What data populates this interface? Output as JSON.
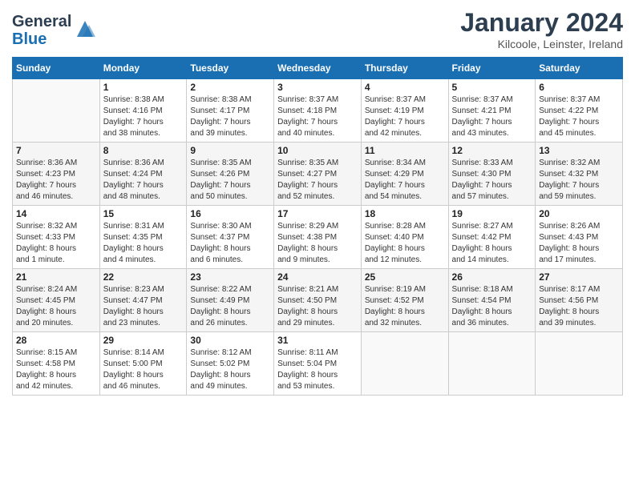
{
  "header": {
    "logo_general": "General",
    "logo_blue": "Blue",
    "month_title": "January 2024",
    "location": "Kilcoole, Leinster, Ireland"
  },
  "days_of_week": [
    "Sunday",
    "Monday",
    "Tuesday",
    "Wednesday",
    "Thursday",
    "Friday",
    "Saturday"
  ],
  "weeks": [
    [
      {
        "day": "",
        "info": ""
      },
      {
        "day": "1",
        "info": "Sunrise: 8:38 AM\nSunset: 4:16 PM\nDaylight: 7 hours\nand 38 minutes."
      },
      {
        "day": "2",
        "info": "Sunrise: 8:38 AM\nSunset: 4:17 PM\nDaylight: 7 hours\nand 39 minutes."
      },
      {
        "day": "3",
        "info": "Sunrise: 8:37 AM\nSunset: 4:18 PM\nDaylight: 7 hours\nand 40 minutes."
      },
      {
        "day": "4",
        "info": "Sunrise: 8:37 AM\nSunset: 4:19 PM\nDaylight: 7 hours\nand 42 minutes."
      },
      {
        "day": "5",
        "info": "Sunrise: 8:37 AM\nSunset: 4:21 PM\nDaylight: 7 hours\nand 43 minutes."
      },
      {
        "day": "6",
        "info": "Sunrise: 8:37 AM\nSunset: 4:22 PM\nDaylight: 7 hours\nand 45 minutes."
      }
    ],
    [
      {
        "day": "7",
        "info": "Sunrise: 8:36 AM\nSunset: 4:23 PM\nDaylight: 7 hours\nand 46 minutes."
      },
      {
        "day": "8",
        "info": "Sunrise: 8:36 AM\nSunset: 4:24 PM\nDaylight: 7 hours\nand 48 minutes."
      },
      {
        "day": "9",
        "info": "Sunrise: 8:35 AM\nSunset: 4:26 PM\nDaylight: 7 hours\nand 50 minutes."
      },
      {
        "day": "10",
        "info": "Sunrise: 8:35 AM\nSunset: 4:27 PM\nDaylight: 7 hours\nand 52 minutes."
      },
      {
        "day": "11",
        "info": "Sunrise: 8:34 AM\nSunset: 4:29 PM\nDaylight: 7 hours\nand 54 minutes."
      },
      {
        "day": "12",
        "info": "Sunrise: 8:33 AM\nSunset: 4:30 PM\nDaylight: 7 hours\nand 57 minutes."
      },
      {
        "day": "13",
        "info": "Sunrise: 8:32 AM\nSunset: 4:32 PM\nDaylight: 7 hours\nand 59 minutes."
      }
    ],
    [
      {
        "day": "14",
        "info": "Sunrise: 8:32 AM\nSunset: 4:33 PM\nDaylight: 8 hours\nand 1 minute."
      },
      {
        "day": "15",
        "info": "Sunrise: 8:31 AM\nSunset: 4:35 PM\nDaylight: 8 hours\nand 4 minutes."
      },
      {
        "day": "16",
        "info": "Sunrise: 8:30 AM\nSunset: 4:37 PM\nDaylight: 8 hours\nand 6 minutes."
      },
      {
        "day": "17",
        "info": "Sunrise: 8:29 AM\nSunset: 4:38 PM\nDaylight: 8 hours\nand 9 minutes."
      },
      {
        "day": "18",
        "info": "Sunrise: 8:28 AM\nSunset: 4:40 PM\nDaylight: 8 hours\nand 12 minutes."
      },
      {
        "day": "19",
        "info": "Sunrise: 8:27 AM\nSunset: 4:42 PM\nDaylight: 8 hours\nand 14 minutes."
      },
      {
        "day": "20",
        "info": "Sunrise: 8:26 AM\nSunset: 4:43 PM\nDaylight: 8 hours\nand 17 minutes."
      }
    ],
    [
      {
        "day": "21",
        "info": "Sunrise: 8:24 AM\nSunset: 4:45 PM\nDaylight: 8 hours\nand 20 minutes."
      },
      {
        "day": "22",
        "info": "Sunrise: 8:23 AM\nSunset: 4:47 PM\nDaylight: 8 hours\nand 23 minutes."
      },
      {
        "day": "23",
        "info": "Sunrise: 8:22 AM\nSunset: 4:49 PM\nDaylight: 8 hours\nand 26 minutes."
      },
      {
        "day": "24",
        "info": "Sunrise: 8:21 AM\nSunset: 4:50 PM\nDaylight: 8 hours\nand 29 minutes."
      },
      {
        "day": "25",
        "info": "Sunrise: 8:19 AM\nSunset: 4:52 PM\nDaylight: 8 hours\nand 32 minutes."
      },
      {
        "day": "26",
        "info": "Sunrise: 8:18 AM\nSunset: 4:54 PM\nDaylight: 8 hours\nand 36 minutes."
      },
      {
        "day": "27",
        "info": "Sunrise: 8:17 AM\nSunset: 4:56 PM\nDaylight: 8 hours\nand 39 minutes."
      }
    ],
    [
      {
        "day": "28",
        "info": "Sunrise: 8:15 AM\nSunset: 4:58 PM\nDaylight: 8 hours\nand 42 minutes."
      },
      {
        "day": "29",
        "info": "Sunrise: 8:14 AM\nSunset: 5:00 PM\nDaylight: 8 hours\nand 46 minutes."
      },
      {
        "day": "30",
        "info": "Sunrise: 8:12 AM\nSunset: 5:02 PM\nDaylight: 8 hours\nand 49 minutes."
      },
      {
        "day": "31",
        "info": "Sunrise: 8:11 AM\nSunset: 5:04 PM\nDaylight: 8 hours\nand 53 minutes."
      },
      {
        "day": "",
        "info": ""
      },
      {
        "day": "",
        "info": ""
      },
      {
        "day": "",
        "info": ""
      }
    ]
  ]
}
